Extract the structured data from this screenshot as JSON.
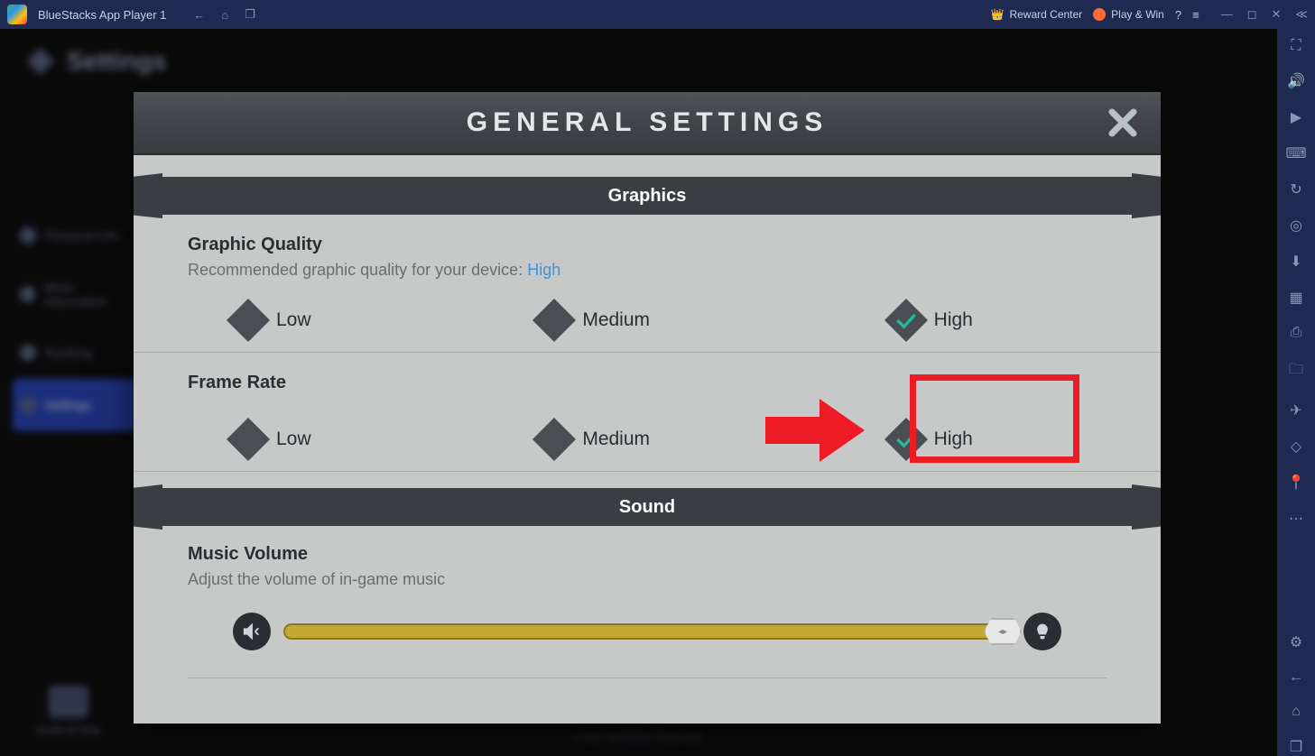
{
  "titlebar": {
    "app_name": "BlueStacks App Player 1",
    "reward_label": "Reward Center",
    "playwin_label": "Play & Win"
  },
  "bg": {
    "page_title": "Settings",
    "sidebar": {
      "personal": "Personal Info",
      "more": "More Information",
      "ranking": "Ranking",
      "settings": "Settings"
    },
    "guide_label": "Guide & Help",
    "copyright": "© IGG All Rights Reserved."
  },
  "modal": {
    "title": "GENERAL SETTINGS",
    "sections": {
      "graphics": "Graphics",
      "sound": "Sound"
    },
    "graphic_quality": {
      "title": "Graphic Quality",
      "desc_prefix": "Recommended graphic quality for your device: ",
      "recommended": "High",
      "options": {
        "low": "Low",
        "medium": "Medium",
        "high": "High"
      },
      "selected": "high"
    },
    "frame_rate": {
      "title": "Frame Rate",
      "options": {
        "low": "Low",
        "medium": "Medium",
        "high": "High"
      },
      "selected": "high"
    },
    "music_volume": {
      "title": "Music Volume",
      "desc": "Adjust the volume of in-game music",
      "value": 100
    }
  }
}
